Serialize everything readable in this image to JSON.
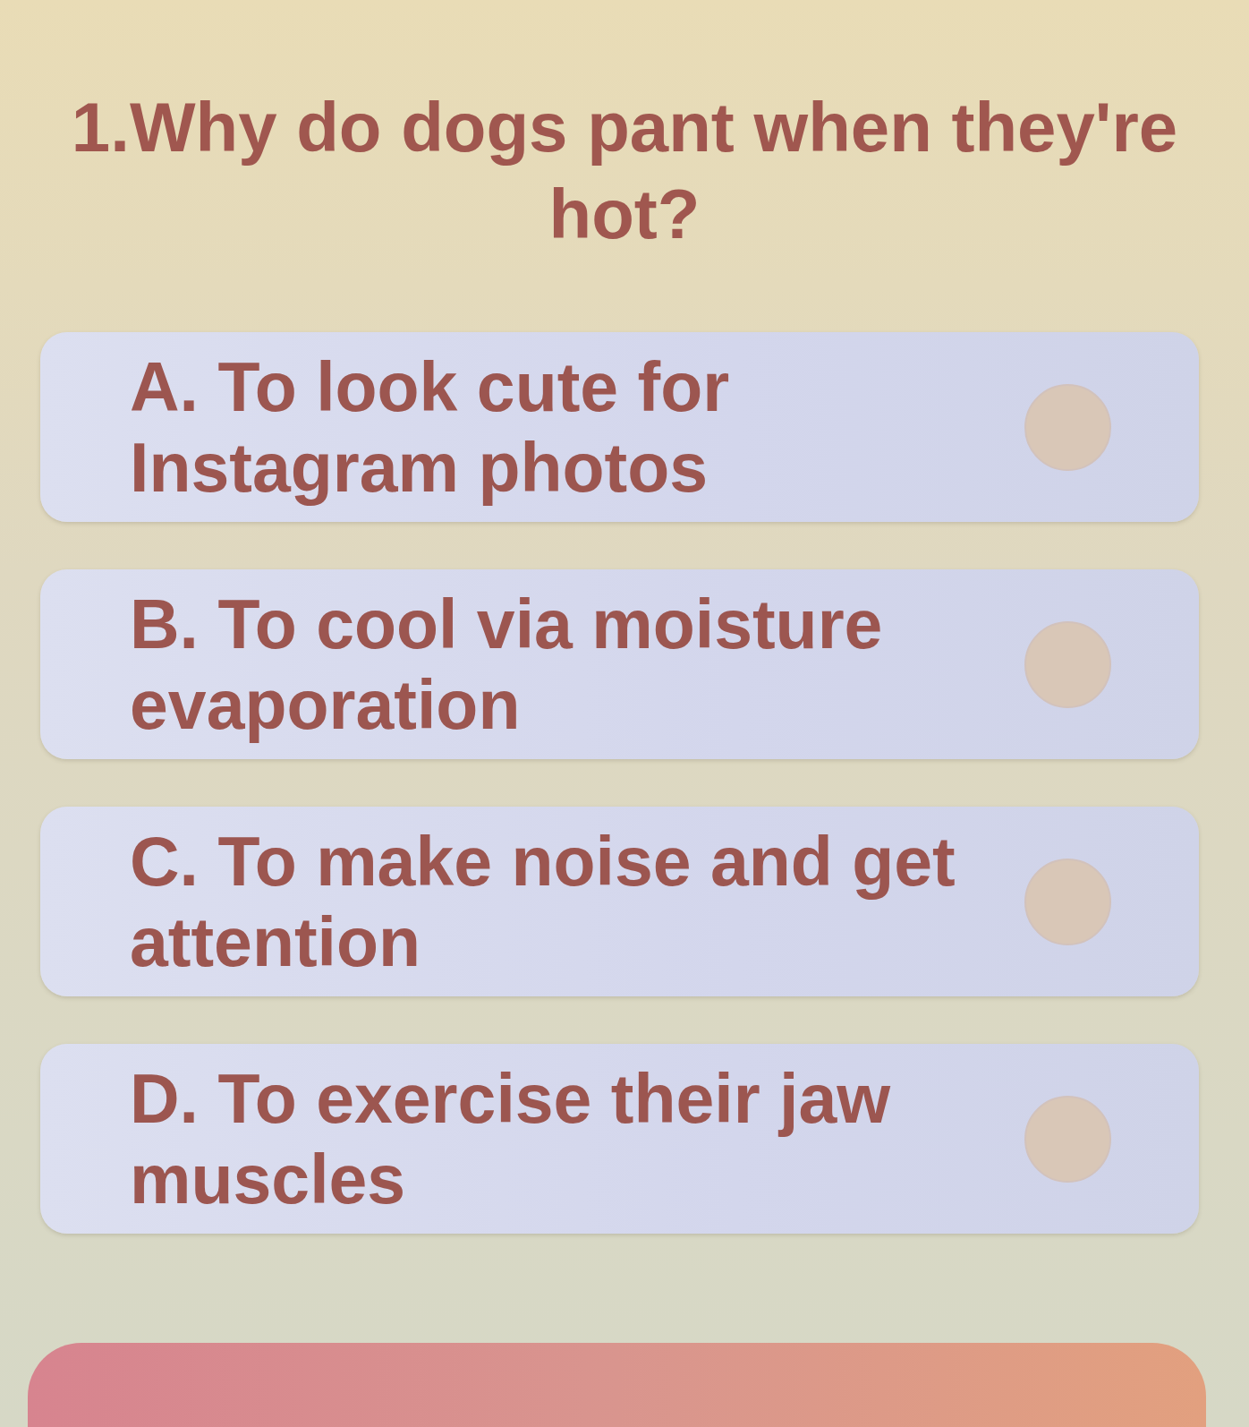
{
  "question": {
    "text": "1.Why do dogs pant when they're hot?"
  },
  "options": [
    {
      "text": "A. To look cute for Instagram photos",
      "selected": false
    },
    {
      "text": "B. To cool via moisture evaporation",
      "selected": false
    },
    {
      "text": "C. To make noise and get attention",
      "selected": false
    },
    {
      "text": "D. To exercise their jaw muscles",
      "selected": false
    }
  ]
}
